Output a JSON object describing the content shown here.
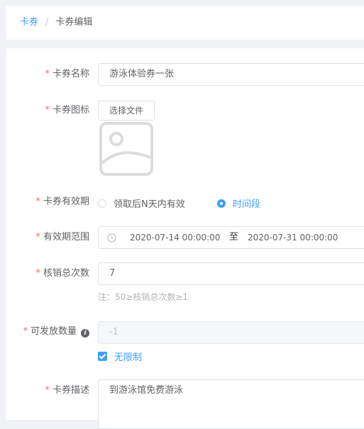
{
  "breadcrumb": {
    "parent": "卡券",
    "separator": "/",
    "current": "卡券编辑"
  },
  "form": {
    "required_mark": "*",
    "name": {
      "label": "卡券名称",
      "value": "游泳体验券一张"
    },
    "icon": {
      "label": "卡券图标",
      "button": "选择文件",
      "preview_icon": "image-placeholder-icon"
    },
    "validity": {
      "label": "卡券有效期",
      "options": [
        "领取后N天内有效",
        "时间段"
      ],
      "selected": "时间段"
    },
    "range": {
      "label": "有效期范围",
      "start": "2020-07-14 00:00:00",
      "separator": "至",
      "end": "2020-07-31 00:00:00"
    },
    "redeem": {
      "label": "核销总次数",
      "value": "7",
      "hint": "注：50≥核销总次数≥1"
    },
    "quantity": {
      "label": "可发放数量",
      "info_icon": "i",
      "value": "-1",
      "unlimited_label": "无限制",
      "unlimited_checked": true
    },
    "description": {
      "label": "卡券描述",
      "value": "到游泳馆免费游泳"
    }
  },
  "colors": {
    "primary": "#409eff",
    "required": "#f56c6c",
    "background": "#f0f2f5"
  }
}
